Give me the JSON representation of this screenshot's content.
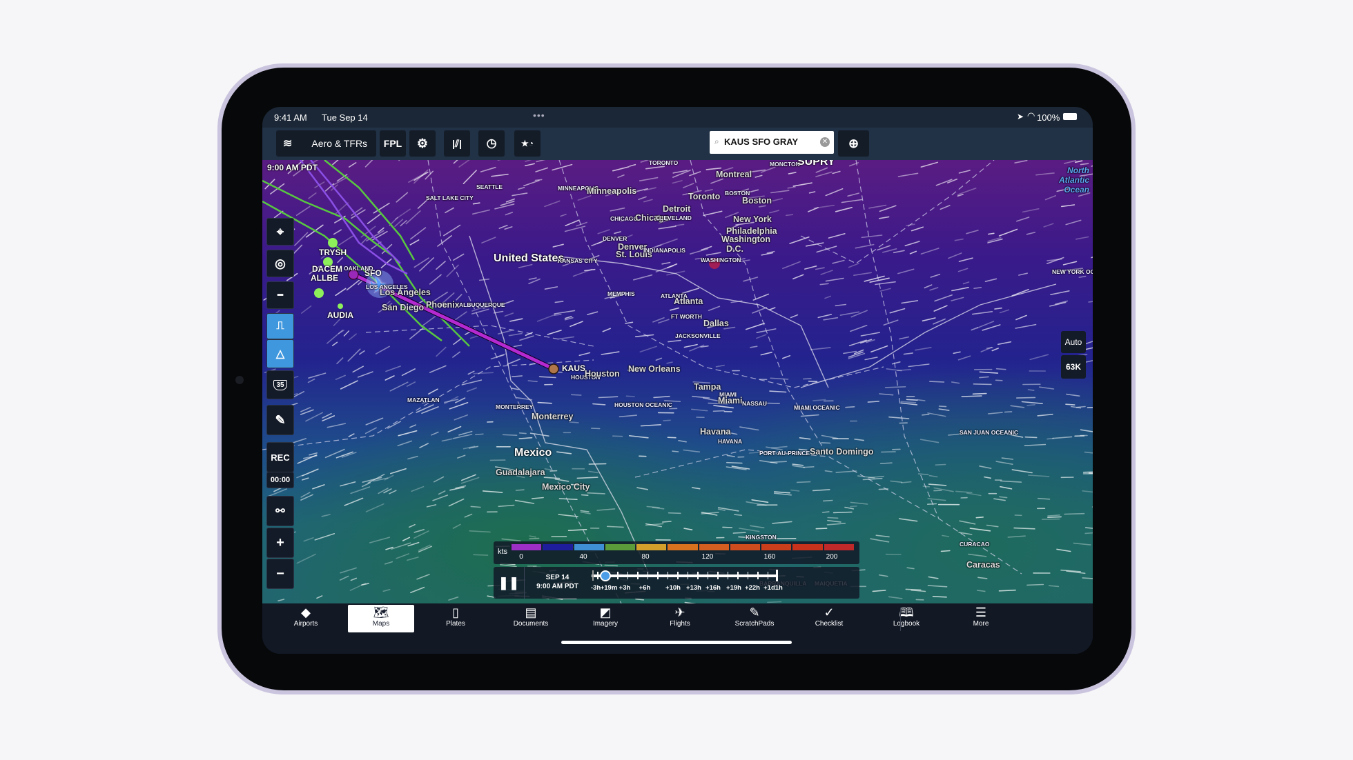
{
  "status_bar": {
    "time": "9:41 AM",
    "date": "Tue Sep 14",
    "battery": "100%"
  },
  "toolbar": {
    "layer_label": "Aero & TFRs",
    "fpl_label": "FPL",
    "search_value": "KAUS SFO GRAY"
  },
  "map": {
    "time_label": "9:00 AM PDT",
    "altitude_mode": "Auto",
    "altitude": "63K",
    "rec_label": "REC",
    "rec_timer": "00:00",
    "shield_number": "35",
    "route": {
      "origin": "SFO",
      "destination": "KAUS",
      "color": "#b42ad0"
    },
    "waypoints": [
      "TRYSH",
      "DACEM",
      "ALLBE",
      "AUDIA"
    ],
    "labels": [
      {
        "text": "SEATTLE"
      },
      {
        "text": "SALT LAKE CITY"
      },
      {
        "text": "MINNEAPOLIS"
      },
      {
        "text": "Minneapolis"
      },
      {
        "text": "TORONTO"
      },
      {
        "text": "MONCTON"
      },
      {
        "text": "SUPRY"
      },
      {
        "text": "Montreal"
      },
      {
        "text": "Toronto"
      },
      {
        "text": "BOSTON"
      },
      {
        "text": "Boston"
      },
      {
        "text": "CHICAGO"
      },
      {
        "text": "Chicago"
      },
      {
        "text": "Detroit"
      },
      {
        "text": "CLEVELAND"
      },
      {
        "text": "New York"
      },
      {
        "text": "Philadelphia"
      },
      {
        "text": "Washington"
      },
      {
        "text": "D.C."
      },
      {
        "text": "DENVER"
      },
      {
        "text": "Denver"
      },
      {
        "text": "United States"
      },
      {
        "text": "KANSAS CITY"
      },
      {
        "text": "St. Louis"
      },
      {
        "text": "INDIANAPOLIS"
      },
      {
        "text": "WASHINGTON"
      },
      {
        "text": "NEW YORK OCEANIC"
      },
      {
        "text": "OAKLAND"
      },
      {
        "text": "Los Angeles"
      },
      {
        "text": "LOS ANGELES"
      },
      {
        "text": "San Diego"
      },
      {
        "text": "Phoenix"
      },
      {
        "text": "ALBUQUERQUE"
      },
      {
        "text": "MEMPHIS"
      },
      {
        "text": "ATLANTA"
      },
      {
        "text": "Atlanta"
      },
      {
        "text": "FT WORTH"
      },
      {
        "text": "Dallas"
      },
      {
        "text": "JACKSONVILLE"
      },
      {
        "text": "HOUSTON"
      },
      {
        "text": "Houston"
      },
      {
        "text": "New Orleans"
      },
      {
        "text": "Tampa"
      },
      {
        "text": "MIAMI"
      },
      {
        "text": "Miami"
      },
      {
        "text": "NASSAU"
      },
      {
        "text": "MIAMI OCEANIC"
      },
      {
        "text": "MAZATLAN"
      },
      {
        "text": "MONTERREY"
      },
      {
        "text": "Monterrey"
      },
      {
        "text": "HOUSTON OCEANIC"
      },
      {
        "text": "Havana"
      },
      {
        "text": "HAVANA"
      },
      {
        "text": "SAN JUAN OCEANIC"
      },
      {
        "text": "Santo Domingo"
      },
      {
        "text": "PORT-AU-PRINCE"
      },
      {
        "text": "Mexico"
      },
      {
        "text": "Guadalajara"
      },
      {
        "text": "Mexico City"
      },
      {
        "text": "KINGSTON"
      },
      {
        "text": "CURACAO"
      },
      {
        "text": "Caracas"
      },
      {
        "text": "BARRANQUILLA"
      },
      {
        "text": "MAIQUETIA"
      },
      {
        "text": "North Atlantic Ocean"
      }
    ]
  },
  "legend": {
    "unit": "kts",
    "ticks": [
      "0",
      "40",
      "80",
      "120",
      "160",
      "200"
    ],
    "colors": [
      "#9b2fc6",
      "#1e1e9c",
      "#3e8fd3",
      "#5b9b3a",
      "#d3a12b",
      "#d8721f",
      "#d45e1f",
      "#cf4c1e",
      "#ca3e1c",
      "#c6321c",
      "#c0292a"
    ]
  },
  "timeline": {
    "date": "SEP 14",
    "time": "9:00 AM PDT",
    "playing": false,
    "ticks": [
      "-3h",
      "+19m",
      "+3h",
      "+6h",
      "+10h",
      "+13h",
      "+16h",
      "+19h",
      "+22h",
      "+1d1h"
    ],
    "current": "+19m"
  },
  "tabs": [
    {
      "label": "Airports",
      "icon": "airports-icon",
      "sym": "◆"
    },
    {
      "label": "Maps",
      "icon": "map-icon",
      "sym": "🗺",
      "selected": true
    },
    {
      "label": "Plates",
      "icon": "plates-icon",
      "sym": "▯"
    },
    {
      "label": "Documents",
      "icon": "documents-icon",
      "sym": "▤"
    },
    {
      "label": "Imagery",
      "icon": "imagery-icon",
      "sym": "◩"
    },
    {
      "label": "Flights",
      "icon": "flights-icon",
      "sym": "✈"
    },
    {
      "label": "ScratchPads",
      "icon": "pencil-icon",
      "sym": "✎"
    },
    {
      "label": "Checklist",
      "icon": "checkmark-icon",
      "sym": "✓"
    },
    {
      "label": "Logbook",
      "icon": "book-icon",
      "sym": "🕮"
    },
    {
      "label": "More",
      "icon": "menu-icon",
      "sym": "☰"
    }
  ]
}
